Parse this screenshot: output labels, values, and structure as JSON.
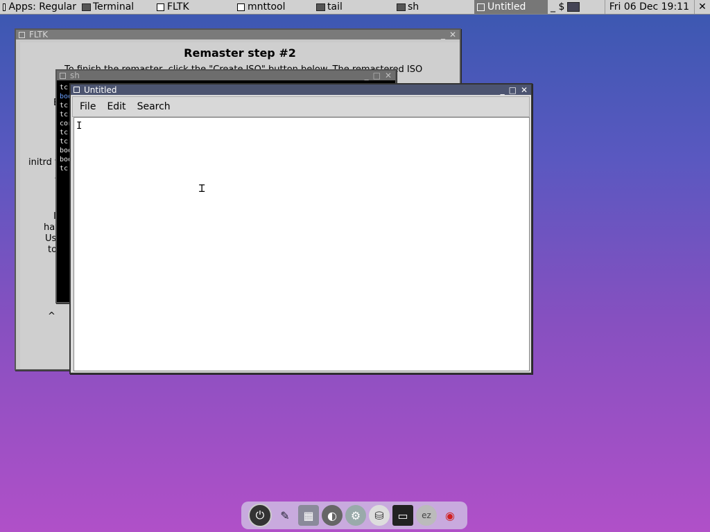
{
  "taskbar": {
    "items": [
      {
        "label": "Apps: Regular",
        "icon": "window-box-icon",
        "active": false
      },
      {
        "label": "Terminal",
        "icon": "terminal-mini-icon",
        "active": false
      },
      {
        "label": "FLTK",
        "icon": "window-box-icon",
        "active": false
      },
      {
        "label": "mnttool",
        "icon": "window-box-icon",
        "active": false
      },
      {
        "label": "tail",
        "icon": "terminal-mini-icon",
        "active": false
      },
      {
        "label": "sh",
        "icon": "terminal-mini-icon",
        "active": false
      },
      {
        "label": "Untitled",
        "icon": "window-box-icon",
        "active": true
      }
    ],
    "pager_symbol": "_ $",
    "clock": "Fri 06 Dec 19:11",
    "close_glyph": "✕"
  },
  "fltk_window": {
    "title": "FLTK",
    "heading": "Remaster step #2",
    "paragraph": "To finish the remaster, click the \"Create ISO\" button below.  The remastered ISO",
    "fragments": {
      "e": "E",
      "initrd": "initrd fi",
      "v": "v",
      "i": "I",
      "hav": "hav",
      "us": "Us",
      "to": "to",
      "caret": "^"
    }
  },
  "sh_window": {
    "title": "sh",
    "lines": [
      "tc(",
      "boo",
      "tc(",
      "tc(",
      "cor",
      "tc(",
      "tc(",
      "boo",
      "boo",
      "tc("
    ]
  },
  "editor_window": {
    "title": "Untitled",
    "menus": [
      "File",
      "Edit",
      "Search"
    ],
    "content": ""
  },
  "dock": {
    "icons": [
      "power-icon",
      "pen-icon",
      "grid-tool-icon",
      "apps-icon",
      "settings-gear-icon",
      "mount-tool-icon",
      "terminal-icon",
      "ez-icon",
      "wifi-icon"
    ]
  },
  "colors": {
    "editor_title": "#4c5470",
    "taskbar": "#d0d0d0",
    "wifi": "#d02020"
  }
}
